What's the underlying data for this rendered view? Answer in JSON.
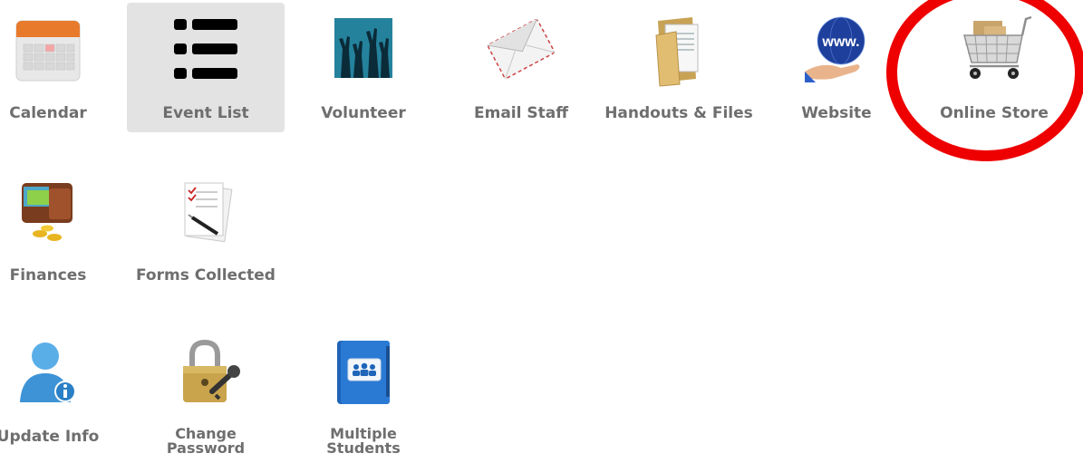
{
  "tiles": [
    {
      "key": "calendar",
      "label": "Calendar",
      "icon": "calendar-icon",
      "selected": false
    },
    {
      "key": "event-list",
      "label": "Event List",
      "icon": "list-icon",
      "selected": true
    },
    {
      "key": "volunteer",
      "label": "Volunteer",
      "icon": "raised-hands-icon",
      "selected": false
    },
    {
      "key": "email-staff",
      "label": "Email Staff",
      "icon": "envelope-icon",
      "selected": false
    },
    {
      "key": "handouts-files",
      "label": "Handouts & Files",
      "icon": "folder-icon",
      "selected": false
    },
    {
      "key": "website",
      "label": "Website",
      "icon": "globe-www-icon",
      "selected": false
    },
    {
      "key": "online-store",
      "label": "Online Store",
      "icon": "shopping-cart-icon",
      "selected": false
    },
    {
      "key": "finances",
      "label": "Finances",
      "icon": "wallet-icon",
      "selected": false
    },
    {
      "key": "forms-collected",
      "label": "Forms Collected",
      "icon": "forms-icon",
      "selected": false
    },
    {
      "key": "update-info",
      "label": "Update Info",
      "icon": "user-info-icon",
      "selected": false
    },
    {
      "key": "change-password",
      "label": "Change\nPassword",
      "icon": "padlock-key-icon",
      "selected": false
    },
    {
      "key": "multiple-students",
      "label": "Multiple\nStudents",
      "icon": "students-book-icon",
      "selected": false
    }
  ],
  "highlight": {
    "target": "online-store",
    "color": "#ee0000"
  }
}
